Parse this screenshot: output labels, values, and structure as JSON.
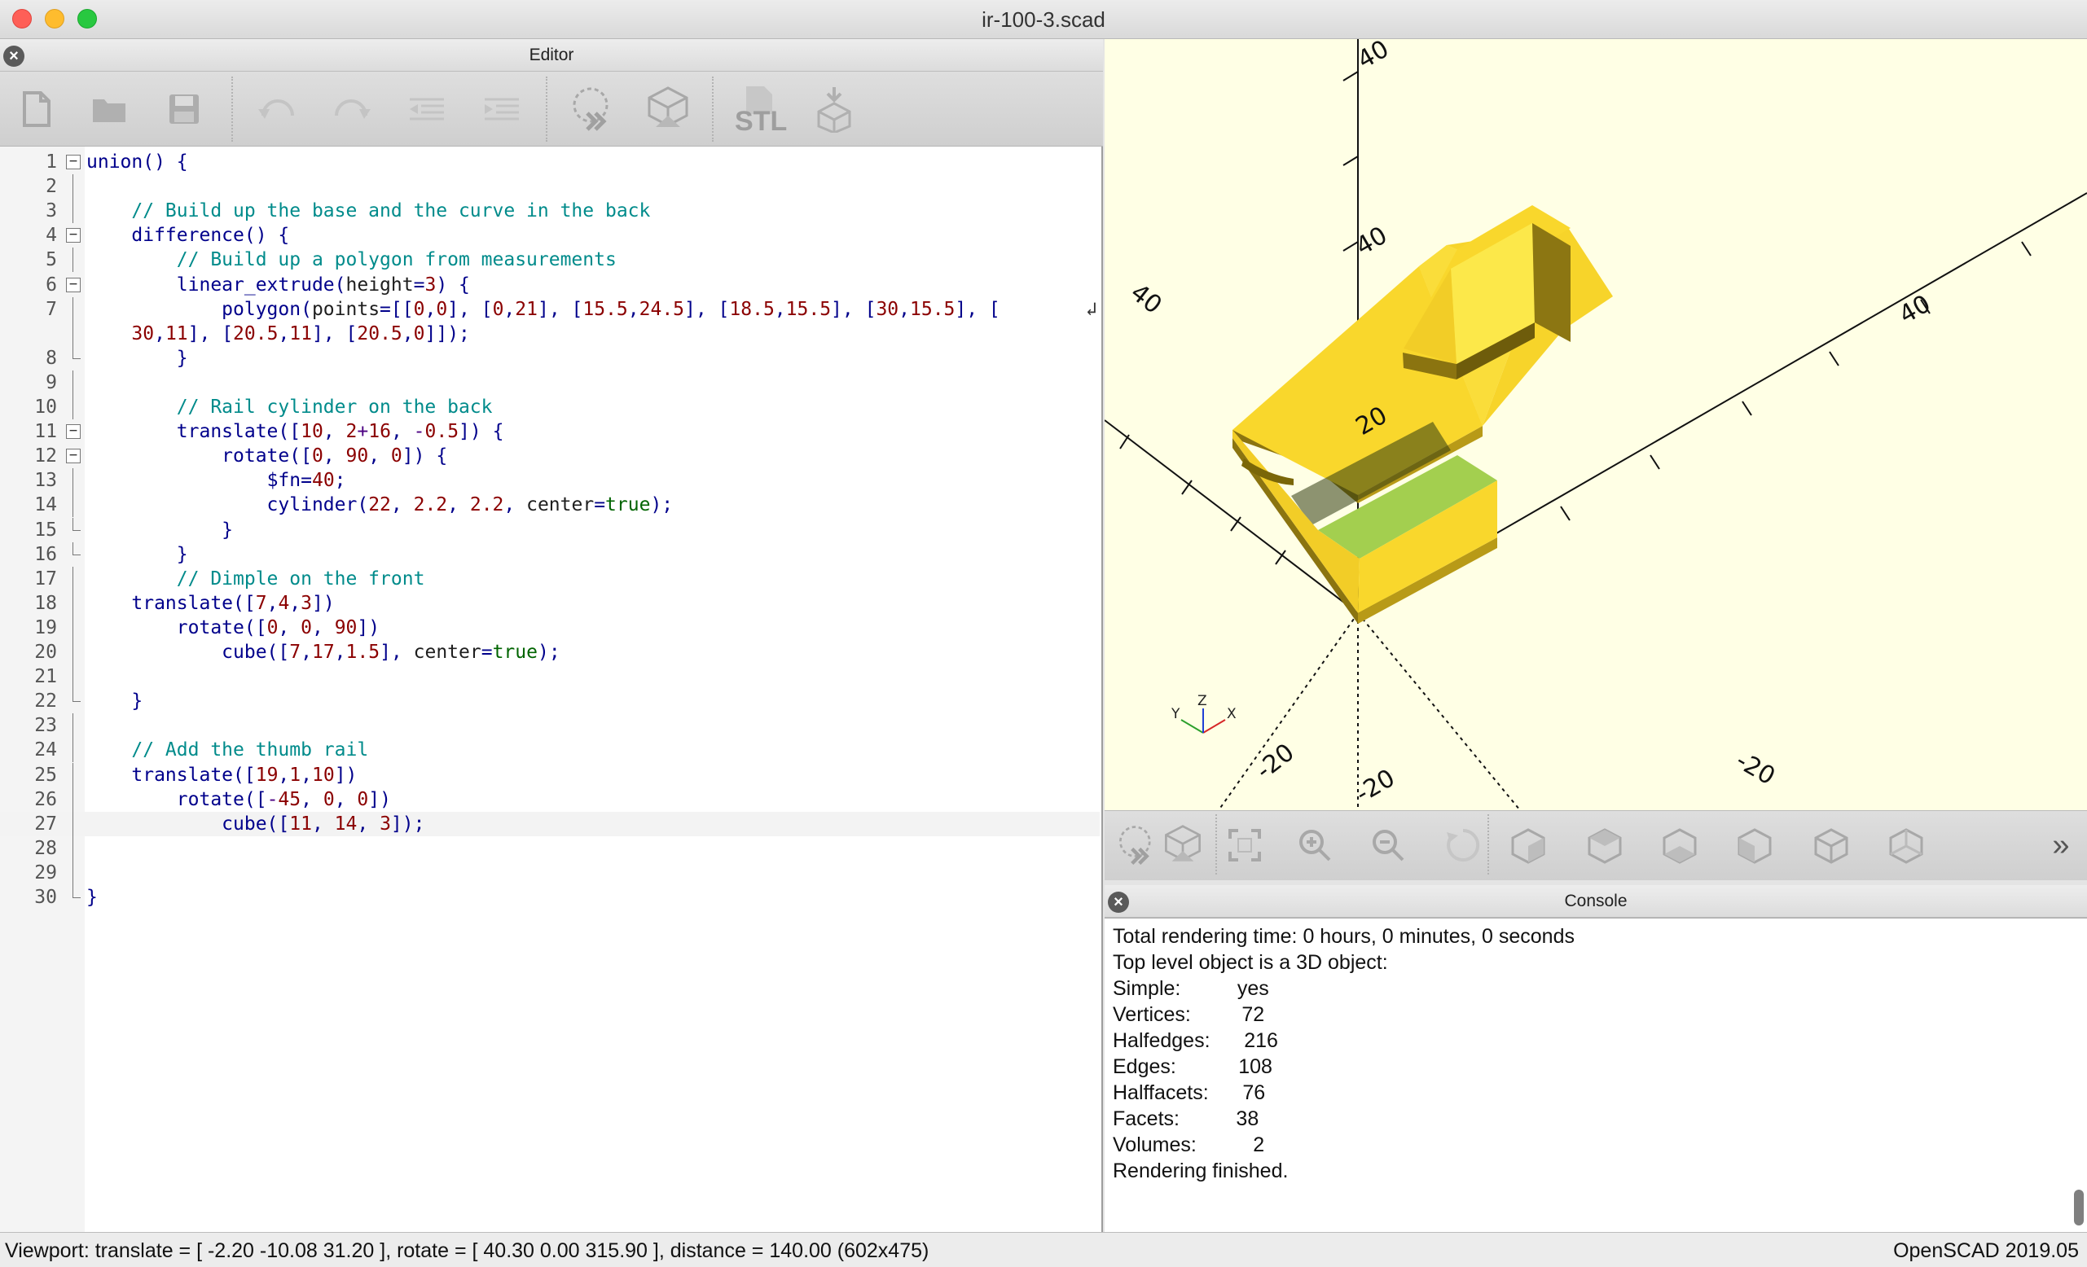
{
  "window": {
    "title": "ir-100-3.scad"
  },
  "editor": {
    "title": "Editor",
    "toolbar": [
      {
        "name": "new-file-icon"
      },
      {
        "name": "open-file-icon"
      },
      {
        "name": "save-icon"
      },
      {
        "name": "undo-icon"
      },
      {
        "name": "redo-icon"
      },
      {
        "name": "unindent-icon"
      },
      {
        "name": "indent-icon"
      },
      {
        "name": "preview-icon"
      },
      {
        "name": "render-icon"
      },
      {
        "name": "export-stl-icon",
        "label": "STL"
      },
      {
        "name": "send-to-print-icon"
      }
    ],
    "current_line": 27,
    "lines": [
      {
        "n": "1",
        "fold": "box",
        "tokens": [
          [
            "k",
            "union() {"
          ]
        ]
      },
      {
        "n": "2",
        "fold": "mid",
        "tokens": []
      },
      {
        "n": "3",
        "fold": "mid",
        "tokens": [
          [
            "k",
            "    "
          ],
          [
            "c",
            "// Build up the base and the curve in the back"
          ]
        ]
      },
      {
        "n": "4",
        "fold": "box",
        "tokens": [
          [
            "k",
            "    difference() {"
          ]
        ]
      },
      {
        "n": "5",
        "fold": "mid",
        "tokens": [
          [
            "k",
            "        "
          ],
          [
            "c",
            "// Build up a polygon from measurements"
          ]
        ]
      },
      {
        "n": "6",
        "fold": "box",
        "tokens": [
          [
            "k",
            "        linear_extrude("
          ],
          [
            "p",
            "height"
          ],
          [
            "k",
            "="
          ],
          [
            "d",
            "3"
          ],
          [
            "k",
            ") {"
          ]
        ]
      },
      {
        "n": "7",
        "fold": "mid",
        "wrap": true,
        "tokens": [
          [
            "k",
            "            polygon("
          ],
          [
            "p",
            "points"
          ],
          [
            "k",
            "=[["
          ],
          [
            "d",
            "0"
          ],
          [
            "k",
            ","
          ],
          [
            "d",
            "0"
          ],
          [
            "k",
            "], ["
          ],
          [
            "d",
            "0"
          ],
          [
            "k",
            ","
          ],
          [
            "d",
            "21"
          ],
          [
            "k",
            "], ["
          ],
          [
            "d",
            "15.5"
          ],
          [
            "k",
            ","
          ],
          [
            "d",
            "24.5"
          ],
          [
            "k",
            "], ["
          ],
          [
            "d",
            "18.5"
          ],
          [
            "k",
            ","
          ],
          [
            "d",
            "15.5"
          ],
          [
            "k",
            "], ["
          ],
          [
            "d",
            "30"
          ],
          [
            "k",
            ","
          ],
          [
            "d",
            "15.5"
          ],
          [
            "k",
            "], ["
          ]
        ]
      },
      {
        "n": "",
        "fold": "mid",
        "tokens": [
          [
            "k",
            "    "
          ],
          [
            "d",
            "30"
          ],
          [
            "k",
            ","
          ],
          [
            "d",
            "11"
          ],
          [
            "k",
            "], ["
          ],
          [
            "d",
            "20.5"
          ],
          [
            "k",
            ","
          ],
          [
            "d",
            "11"
          ],
          [
            "k",
            "], ["
          ],
          [
            "d",
            "20.5"
          ],
          [
            "k",
            ","
          ],
          [
            "d",
            "0"
          ],
          [
            "k",
            "]]);"
          ]
        ]
      },
      {
        "n": "8",
        "fold": "end",
        "tokens": [
          [
            "k",
            "        }"
          ]
        ]
      },
      {
        "n": "9",
        "fold": "mid",
        "tokens": []
      },
      {
        "n": "10",
        "fold": "mid",
        "tokens": [
          [
            "k",
            "        "
          ],
          [
            "c",
            "// Rail cylinder on the back"
          ]
        ]
      },
      {
        "n": "11",
        "fold": "box",
        "tokens": [
          [
            "k",
            "        translate(["
          ],
          [
            "d",
            "10"
          ],
          [
            "k",
            ", "
          ],
          [
            "d",
            "2"
          ],
          [
            "o",
            "+"
          ],
          [
            "d",
            "16"
          ],
          [
            "k",
            ", "
          ],
          [
            "o",
            "-"
          ],
          [
            "d",
            "0.5"
          ],
          [
            "k",
            "]) {"
          ]
        ]
      },
      {
        "n": "12",
        "fold": "box",
        "tokens": [
          [
            "k",
            "            rotate(["
          ],
          [
            "d",
            "0"
          ],
          [
            "k",
            ", "
          ],
          [
            "d",
            "90"
          ],
          [
            "k",
            ", "
          ],
          [
            "d",
            "0"
          ],
          [
            "k",
            "]) {"
          ]
        ]
      },
      {
        "n": "13",
        "fold": "mid",
        "tokens": [
          [
            "k",
            "                "
          ],
          [
            "k",
            "$fn"
          ],
          [
            "k",
            "="
          ],
          [
            "d",
            "40"
          ],
          [
            "k",
            ";"
          ]
        ]
      },
      {
        "n": "14",
        "fold": "mid",
        "tokens": [
          [
            "k",
            "                cylinder("
          ],
          [
            "d",
            "22"
          ],
          [
            "k",
            ", "
          ],
          [
            "d",
            "2.2"
          ],
          [
            "k",
            ", "
          ],
          [
            "d",
            "2.2"
          ],
          [
            "k",
            ", "
          ],
          [
            "p",
            "center"
          ],
          [
            "k",
            "="
          ],
          [
            "b",
            "true"
          ],
          [
            "k",
            ");"
          ]
        ]
      },
      {
        "n": "15",
        "fold": "end",
        "tokens": [
          [
            "k",
            "            }"
          ]
        ]
      },
      {
        "n": "16",
        "fold": "end",
        "tokens": [
          [
            "k",
            "        }"
          ]
        ]
      },
      {
        "n": "17",
        "fold": "mid",
        "tokens": [
          [
            "k",
            "        "
          ],
          [
            "c",
            "// Dimple on the front"
          ]
        ]
      },
      {
        "n": "18",
        "fold": "mid",
        "tokens": [
          [
            "k",
            "    translate(["
          ],
          [
            "d",
            "7"
          ],
          [
            "k",
            ","
          ],
          [
            "d",
            "4"
          ],
          [
            "k",
            ","
          ],
          [
            "d",
            "3"
          ],
          [
            "k",
            "])"
          ]
        ]
      },
      {
        "n": "19",
        "fold": "mid",
        "tokens": [
          [
            "k",
            "        rotate(["
          ],
          [
            "d",
            "0"
          ],
          [
            "k",
            ", "
          ],
          [
            "d",
            "0"
          ],
          [
            "k",
            ", "
          ],
          [
            "d",
            "90"
          ],
          [
            "k",
            "])"
          ]
        ]
      },
      {
        "n": "20",
        "fold": "mid",
        "tokens": [
          [
            "k",
            "            cube(["
          ],
          [
            "d",
            "7"
          ],
          [
            "k",
            ","
          ],
          [
            "d",
            "17"
          ],
          [
            "k",
            ","
          ],
          [
            "d",
            "1.5"
          ],
          [
            "k",
            "], "
          ],
          [
            "p",
            "center"
          ],
          [
            "k",
            "="
          ],
          [
            "b",
            "true"
          ],
          [
            "k",
            ");"
          ]
        ]
      },
      {
        "n": "21",
        "fold": "mid",
        "tokens": []
      },
      {
        "n": "22",
        "fold": "end",
        "tokens": [
          [
            "k",
            "    }"
          ]
        ]
      },
      {
        "n": "23",
        "fold": "mid",
        "tokens": []
      },
      {
        "n": "24",
        "fold": "mid",
        "tokens": [
          [
            "k",
            "    "
          ],
          [
            "c",
            "// Add the thumb rail"
          ]
        ]
      },
      {
        "n": "25",
        "fold": "mid",
        "tokens": [
          [
            "k",
            "    translate(["
          ],
          [
            "d",
            "19"
          ],
          [
            "k",
            ","
          ],
          [
            "d",
            "1"
          ],
          [
            "k",
            ","
          ],
          [
            "d",
            "10"
          ],
          [
            "k",
            "])"
          ]
        ]
      },
      {
        "n": "26",
        "fold": "mid",
        "tokens": [
          [
            "k",
            "        rotate(["
          ],
          [
            "o",
            "-"
          ],
          [
            "d",
            "45"
          ],
          [
            "k",
            ", "
          ],
          [
            "d",
            "0"
          ],
          [
            "k",
            ", "
          ],
          [
            "d",
            "0"
          ],
          [
            "k",
            "])"
          ]
        ]
      },
      {
        "n": "27",
        "fold": "mid",
        "tokens": [
          [
            "k",
            "            cube(["
          ],
          [
            "d",
            "11"
          ],
          [
            "k",
            ", "
          ],
          [
            "d",
            "14"
          ],
          [
            "k",
            ", "
          ],
          [
            "d",
            "3"
          ],
          [
            "k",
            "]);"
          ]
        ]
      },
      {
        "n": "28",
        "fold": "mid",
        "tokens": []
      },
      {
        "n": "29",
        "fold": "mid",
        "tokens": []
      },
      {
        "n": "30",
        "fold": "end",
        "tokens": [
          [
            "k",
            "}"
          ]
        ]
      }
    ]
  },
  "viewport": {
    "background_color": "#ffffe5",
    "model_color": "#f9d72c",
    "dimple_color": "#a3cf4f",
    "axis_labels": {
      "x_pos": "40",
      "y_pos": "40",
      "z_pos": "40",
      "z_mid": "20",
      "x_neg": "-20",
      "y_neg": "-20",
      "z_neg": "-20",
      "z_top": "40"
    },
    "gizmo_labels": {
      "x": "X",
      "y": "Y",
      "z": "Z"
    }
  },
  "view_toolbar": [
    {
      "name": "preview-icon"
    },
    {
      "name": "render-icon"
    },
    {
      "name": "view-all-icon"
    },
    {
      "name": "zoom-in-icon"
    },
    {
      "name": "zoom-out-icon"
    },
    {
      "name": "reset-view-icon"
    },
    {
      "name": "view-right-icon"
    },
    {
      "name": "view-top-icon"
    },
    {
      "name": "view-bottom-icon"
    },
    {
      "name": "view-left-icon"
    },
    {
      "name": "view-front-icon"
    },
    {
      "name": "view-back-icon"
    },
    {
      "name": "more-icon",
      "label": "»"
    }
  ],
  "console": {
    "title": "Console",
    "lines": [
      "Total rendering time: 0 hours, 0 minutes, 0 seconds",
      "Top level object is a 3D object:",
      "Simple:          yes",
      "Vertices:         72",
      "Halfedges:      216",
      "Edges:           108",
      "Halffacets:      76",
      "Facets:          38",
      "Volumes:          2",
      "Rendering finished."
    ]
  },
  "status": {
    "viewport": "Viewport: translate = [ -2.20 -10.08 31.20 ], rotate = [ 40.30 0.00 315.90 ], distance = 140.00 (602x475)",
    "version": "OpenSCAD 2019.05"
  }
}
